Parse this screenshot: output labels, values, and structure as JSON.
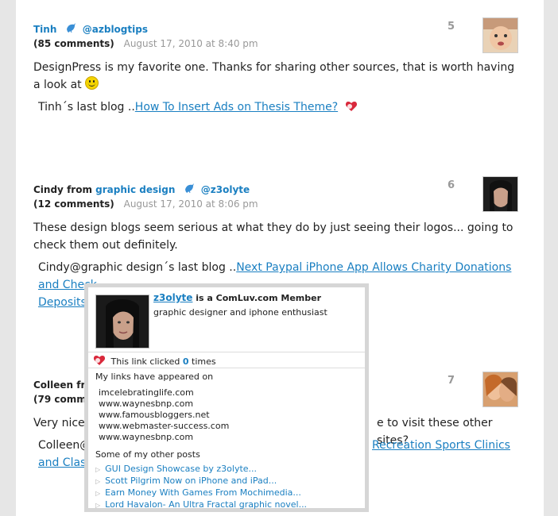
{
  "comments": [
    {
      "author_name": "Tinh",
      "twitter_handle": "@azblogtips",
      "comment_count": "(85 comments)",
      "date": "August 17, 2010 at 8:40 pm",
      "number": "5",
      "text": "DesignPress is my favorite one. Thanks for sharing other sources, that is worth having a look at",
      "last_blog_prefix": "Tinh´s last blog ..",
      "last_blog_link": "How To Insert Ads on Thesis Theme?"
    },
    {
      "author_name": "Cindy",
      "from_label": "from",
      "site_link": "graphic design",
      "twitter_handle": "@z3olyte",
      "comment_count": "(12 comments)",
      "date": "August 17, 2010 at 8:06 pm",
      "number": "6",
      "text": "These design blogs seem serious at what they do by just seeing their logos... going to check them out definitely.",
      "last_blog_prefix": "Cindy@graphic design´s last blog ..",
      "last_blog_link_line1": "Next Paypal iPhone App Allows Charity Donations and Check",
      "last_blog_link_line2": "Deposits"
    },
    {
      "author_name": "Colleen fro",
      "comment_count": "(79 comme",
      "number": "7",
      "text_left": "Very nice l",
      "text_right": "e to visit these other sites?",
      "last_blog_prefix": "Colleen@",
      "last_blog_link_right": "Recreation Sports Clinics",
      "last_blog_link_line2": "and Class"
    }
  ],
  "popup": {
    "username": "z3olyte",
    "member_text": "is a ComLuv.com Member",
    "description": "graphic designer and iphone enthusiast",
    "clicks_prefix": "This link clicked",
    "clicks_count": "0",
    "clicks_suffix": "times",
    "appeared_label": "My links have appeared on",
    "sites": [
      "imcelebratinglife.com",
      "www.waynesbnp.com",
      "www.famousbloggers.net",
      "www.webmaster-success.com",
      "www.waynesbnp.com"
    ],
    "other_posts_label": "Some of my other posts",
    "posts": [
      "GUI Design Showcase by z3olyte...",
      "Scott Pilgrim Now on iPhone and iPad...",
      "Earn Money With Games From Mochimedia...",
      "Lord Havalon- An Ultra Fractal graphic novel..."
    ]
  }
}
